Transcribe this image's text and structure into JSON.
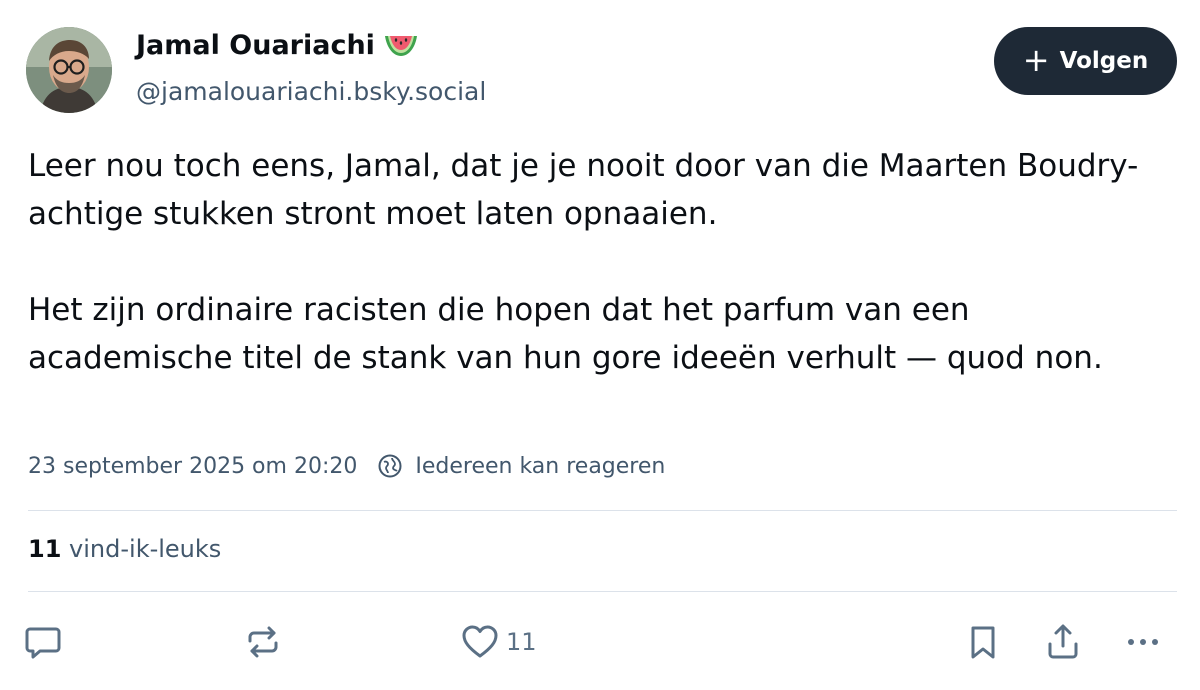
{
  "author": {
    "name": "Jamal Ouariachi",
    "handle": "@jamalouariachi.bsky.social",
    "name_emoji": "watermelon-emoji"
  },
  "follow_button": {
    "icon": "plus-icon",
    "label": "Volgen"
  },
  "post": {
    "paragraphs": [
      "Leer nou toch eens, Jamal, dat je je nooit door van die Maarten Boudry-achtige stukken stront moet laten opnaaien.",
      "Het zijn ordinaire racisten die hopen dat het parfum van een academische titel de stank van hun gore ideeën verhult — quod non."
    ],
    "timestamp": "23 september 2025 om 20:20",
    "reply_setting": "Iedereen kan reageren"
  },
  "stats": {
    "likes_count": "11",
    "likes_label": "vind-ik-leuks"
  },
  "actions": {
    "reply_icon": "comment-icon",
    "repost_icon": "repost-icon",
    "like_icon": "heart-icon",
    "like_count": "11",
    "bookmark_icon": "bookmark-icon",
    "share_icon": "share-icon",
    "more_icon": "more-icon"
  },
  "colors": {
    "text": "#0b0f14",
    "muted": "#42576c",
    "button_bg": "#1e2936",
    "divider": "#dce2ea"
  }
}
